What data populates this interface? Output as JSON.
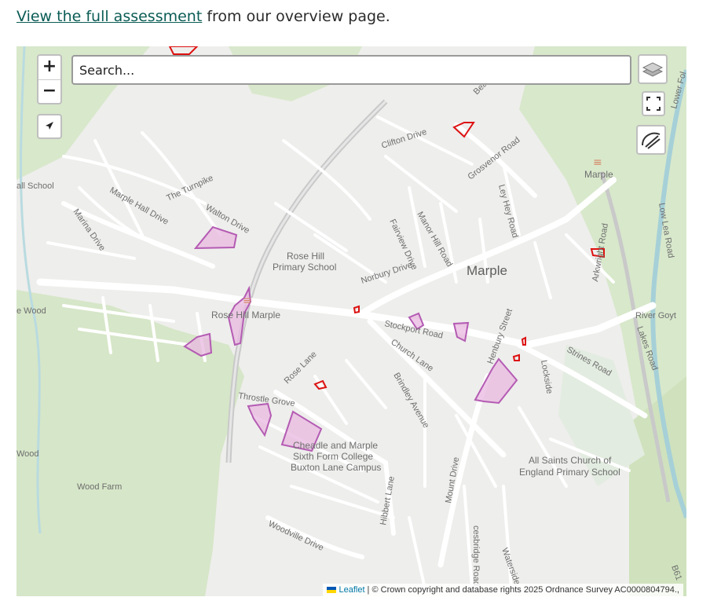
{
  "intro": {
    "link_text": "View the full assessment",
    "rest_text": " from our overview page."
  },
  "search": {
    "placeholder": "Search..."
  },
  "zoom": {
    "in_label": "+",
    "out_label": "−"
  },
  "attribution": {
    "leaflet_label": "Leaflet",
    "text": " | © Crown copyright and database rights 2025 Ordnance Survey AC0000804794.,"
  },
  "map_labels": {
    "marple": "Marple",
    "marple_station": "Marple",
    "rose_hill_marple": "Rose Hill Marple",
    "rose_hill_school_1": "Rose Hill",
    "rose_hill_school_2": "Primary School",
    "college_1": "Cheadle and Marple",
    "college_2": "Sixth Form College",
    "college_3": "Buxton Lane Campus",
    "all_saints_1": "All Saints Church of",
    "all_saints_2": "England Primary School",
    "wood_farm": "Wood Farm",
    "hall_school": "all School",
    "le_wood": "e Wood",
    "wood": "Wood",
    "marple_hall_drive": "Marple Hall Drive",
    "marina_drive": "Marina Drive",
    "the_turnpike": "The Turnpike",
    "walton_drive": "Walton Drive",
    "clifton_drive": "Clifton Drive",
    "grosvenor_road": "Grosvenor Road",
    "ley_hey_road": "Ley Hey Road",
    "fairview_drive": "Fairview Drive",
    "manor_hill_road": "Manor Hill Road",
    "norbury_drive": "Norbury Drive",
    "stockport_road": "Stockport Road",
    "church_lane": "Church Lane",
    "rose_lane": "Rose Lane",
    "throstle_grove": "Throstle Grove",
    "brindley_avenue": "Brindley Avenue",
    "strines_road": "Strines Road",
    "lockside": "Lockside",
    "arkwright_road": "Arkwright Road",
    "lakes_road": "Lakes Road",
    "river_goyt": "River Goyt",
    "hibbert_lane": "Hibbert Lane",
    "mount_drive": "Mount Drive",
    "woodville_drive": "Woodville Drive",
    "waterside": "Waterside",
    "lower_fold": "Lower Fol",
    "low_lea_road": "Low Lea Road",
    "beacon": "Bea",
    "b61": "B61",
    "henbury_street": "Henbury Street",
    "queensbridge_road": "cesbridge Road"
  }
}
